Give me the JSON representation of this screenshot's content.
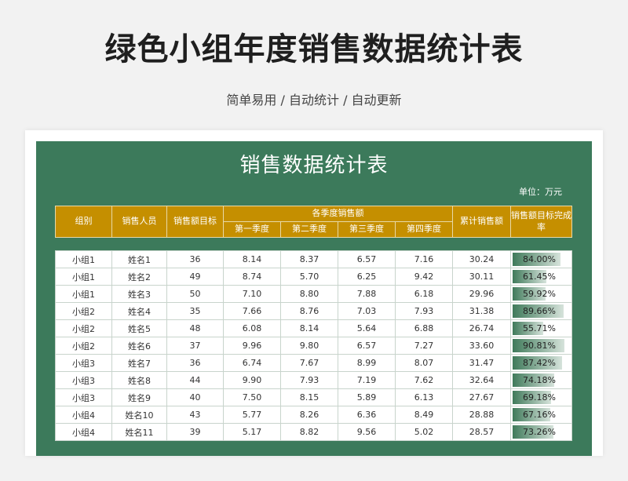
{
  "header": {
    "title": "绿色小组年度销售数据统计表",
    "subtitle": "简单易用 / 自动统计 / 自动更新"
  },
  "sheet": {
    "title": "销售数据统计表",
    "unit": "单位：万元"
  },
  "table": {
    "headers": {
      "group": "组别",
      "person": "销售人员",
      "target": "销售额目标",
      "quarterly": "各季度销售额",
      "q1": "第一季度",
      "q2": "第二季度",
      "q3": "第三季度",
      "q4": "第四季度",
      "total": "累计销售额",
      "rate": "销售额目标完成率"
    },
    "rows": [
      {
        "group": "小组1",
        "person": "姓名1",
        "target": "36",
        "q1": "8.14",
        "q2": "8.37",
        "q3": "6.57",
        "q4": "7.16",
        "total": "30.24",
        "rate": "84.00%",
        "rate_value": 0.84
      },
      {
        "group": "小组1",
        "person": "姓名2",
        "target": "49",
        "q1": "8.74",
        "q2": "5.70",
        "q3": "6.25",
        "q4": "9.42",
        "total": "30.11",
        "rate": "61.45%",
        "rate_value": 0.6145
      },
      {
        "group": "小组1",
        "person": "姓名3",
        "target": "50",
        "q1": "7.10",
        "q2": "8.80",
        "q3": "7.88",
        "q4": "6.18",
        "total": "29.96",
        "rate": "59.92%",
        "rate_value": 0.5992
      },
      {
        "group": "小组2",
        "person": "姓名4",
        "target": "35",
        "q1": "7.66",
        "q2": "8.76",
        "q3": "7.03",
        "q4": "7.93",
        "total": "31.38",
        "rate": "89.66%",
        "rate_value": 0.8966
      },
      {
        "group": "小组2",
        "person": "姓名5",
        "target": "48",
        "q1": "6.08",
        "q2": "8.14",
        "q3": "5.64",
        "q4": "6.88",
        "total": "26.74",
        "rate": "55.71%",
        "rate_value": 0.5571
      },
      {
        "group": "小组2",
        "person": "姓名6",
        "target": "37",
        "q1": "9.96",
        "q2": "9.80",
        "q3": "6.57",
        "q4": "7.27",
        "total": "33.60",
        "rate": "90.81%",
        "rate_value": 0.9081
      },
      {
        "group": "小组3",
        "person": "姓名7",
        "target": "36",
        "q1": "6.74",
        "q2": "7.67",
        "q3": "8.99",
        "q4": "8.07",
        "total": "31.47",
        "rate": "87.42%",
        "rate_value": 0.8742
      },
      {
        "group": "小组3",
        "person": "姓名8",
        "target": "44",
        "q1": "9.90",
        "q2": "7.93",
        "q3": "7.19",
        "q4": "7.62",
        "total": "32.64",
        "rate": "74.18%",
        "rate_value": 0.7418
      },
      {
        "group": "小组3",
        "person": "姓名9",
        "target": "40",
        "q1": "7.50",
        "q2": "8.15",
        "q3": "5.89",
        "q4": "6.13",
        "total": "27.67",
        "rate": "69.18%",
        "rate_value": 0.6918
      },
      {
        "group": "小组4",
        "person": "姓名10",
        "target": "43",
        "q1": "5.77",
        "q2": "8.26",
        "q3": "6.36",
        "q4": "8.49",
        "total": "28.88",
        "rate": "67.16%",
        "rate_value": 0.6716
      },
      {
        "group": "小组4",
        "person": "姓名11",
        "target": "39",
        "q1": "5.17",
        "q2": "8.82",
        "q3": "9.56",
        "q4": "5.02",
        "total": "28.57",
        "rate": "73.26%",
        "rate_value": 0.7326
      }
    ]
  }
}
